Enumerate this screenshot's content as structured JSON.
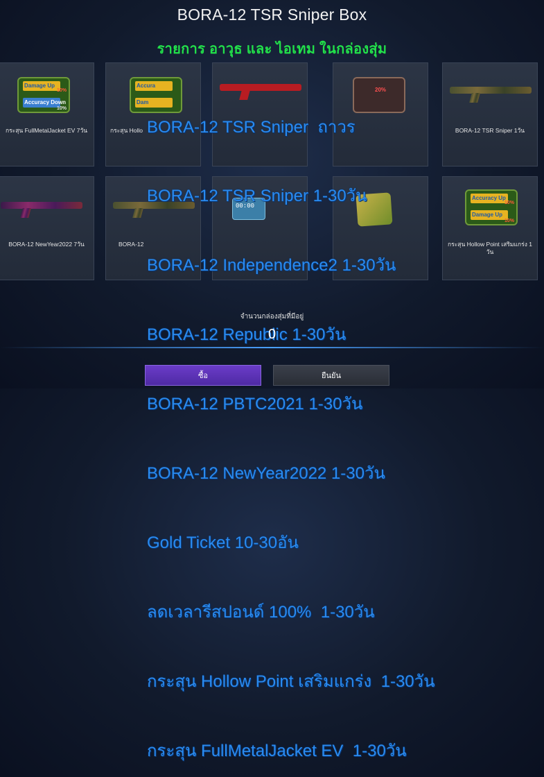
{
  "window": {
    "title": "BORA-12 TSR Sniper Box",
    "subtitle": "รายการ อาวุธ และ ไอเทม ในกล่องสุ่ม"
  },
  "items": [
    {
      "label": "กระสุน FullMetalJacket EV 7วัน",
      "icon": "damage-accuracy-badge-icon",
      "badge_top": "Damage Up",
      "badge_bottom": "Accuracy Down",
      "pct_top": "10%",
      "pct_bottom": "10%"
    },
    {
      "label": "กระสุน Hollo",
      "icon": "accuracy-damage-badge-icon",
      "badge_top": "Accura",
      "badge_bottom": "Dam"
    },
    {
      "label": "",
      "icon": "red-rifle-icon"
    },
    {
      "label": "",
      "icon": "percent-item-icon",
      "pct": "20%"
    },
    {
      "label": "BORA-12 TSR Sniper 1วัน",
      "icon": "camo-rifle-icon"
    },
    {
      "label": "BORA-12 NewYear2022 7วัน",
      "icon": "purple-rifle-icon"
    },
    {
      "label": "BORA-12",
      "icon": "camo-rifle-icon"
    },
    {
      "label": "",
      "icon": "respawn-clock-icon",
      "clock": "00:00"
    },
    {
      "label": "",
      "icon": "gold-ticket-icon"
    },
    {
      "label": "กระสุน Hollow Point เสริมแกร่ง 1 วัน",
      "icon": "accuracy-damage-badge-icon",
      "badge_top": "Accuracy Up",
      "badge_bottom": "Damage Up",
      "pct_top": "10%",
      "pct_bottom": "10%"
    }
  ],
  "overlay_list": [
    "BORA-12 TSR Sniper  ถาวร",
    "BORA-12 TSR Sniper 1-30วัน",
    "BORA-12 Independence2 1-30วัน",
    "BORA-12 Republic 1-30วัน",
    "BORA-12 PBTC2021 1-30วัน",
    "BORA-12 NewYear2022 1-30วัน",
    "Gold Ticket 10-30อัน",
    "ลดเวลารีสปอนด์ 100%  1-30วัน",
    "กระสุน Hollow Point เสริมแกร่ง  1-30วัน",
    "กระสุน FullMetalJacket EV  1-30วัน"
  ],
  "counter": {
    "label": "จำนวนกล่องสุ่มที่มีอยู่",
    "value": "0"
  },
  "buttons": {
    "buy": "ซื้อ",
    "confirm": "ยืนยัน"
  },
  "colors": {
    "subtitle": "#22e04a",
    "overlay_text": "#2a8bf0",
    "buy_button": "#5a32b4"
  }
}
